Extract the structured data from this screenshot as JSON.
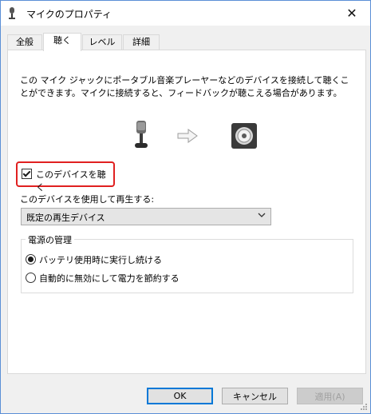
{
  "window": {
    "title": "マイクのプロパティ",
    "close_glyph": "✕"
  },
  "tabs": [
    {
      "label": "全般",
      "active": false
    },
    {
      "label": "聴く",
      "active": true
    },
    {
      "label": "レベル",
      "active": false
    },
    {
      "label": "詳細",
      "active": false
    }
  ],
  "listen": {
    "description": "この マイク ジャックにポータブル音楽プレーヤーなどのデバイスを接続して聴くことができます。マイクに接続すると、フィードバックが聴こえる場合があります。",
    "listen_checkbox": {
      "label": "このデバイスを聴く",
      "checked": true
    },
    "playback_label": "このデバイスを使用して再生する:",
    "playback_device": "既定の再生デバイス",
    "power": {
      "title": "電源の管理",
      "options": [
        {
          "label": "バッテリ使用時に実行し続ける",
          "selected": true
        },
        {
          "label": "自動的に無効にして電力を節約する",
          "selected": false
        }
      ]
    }
  },
  "buttons": {
    "ok": "OK",
    "cancel": "キャンセル",
    "apply": "適用(A)"
  },
  "colors": {
    "highlight_border": "#e02020",
    "default_button_border": "#0078d7"
  }
}
